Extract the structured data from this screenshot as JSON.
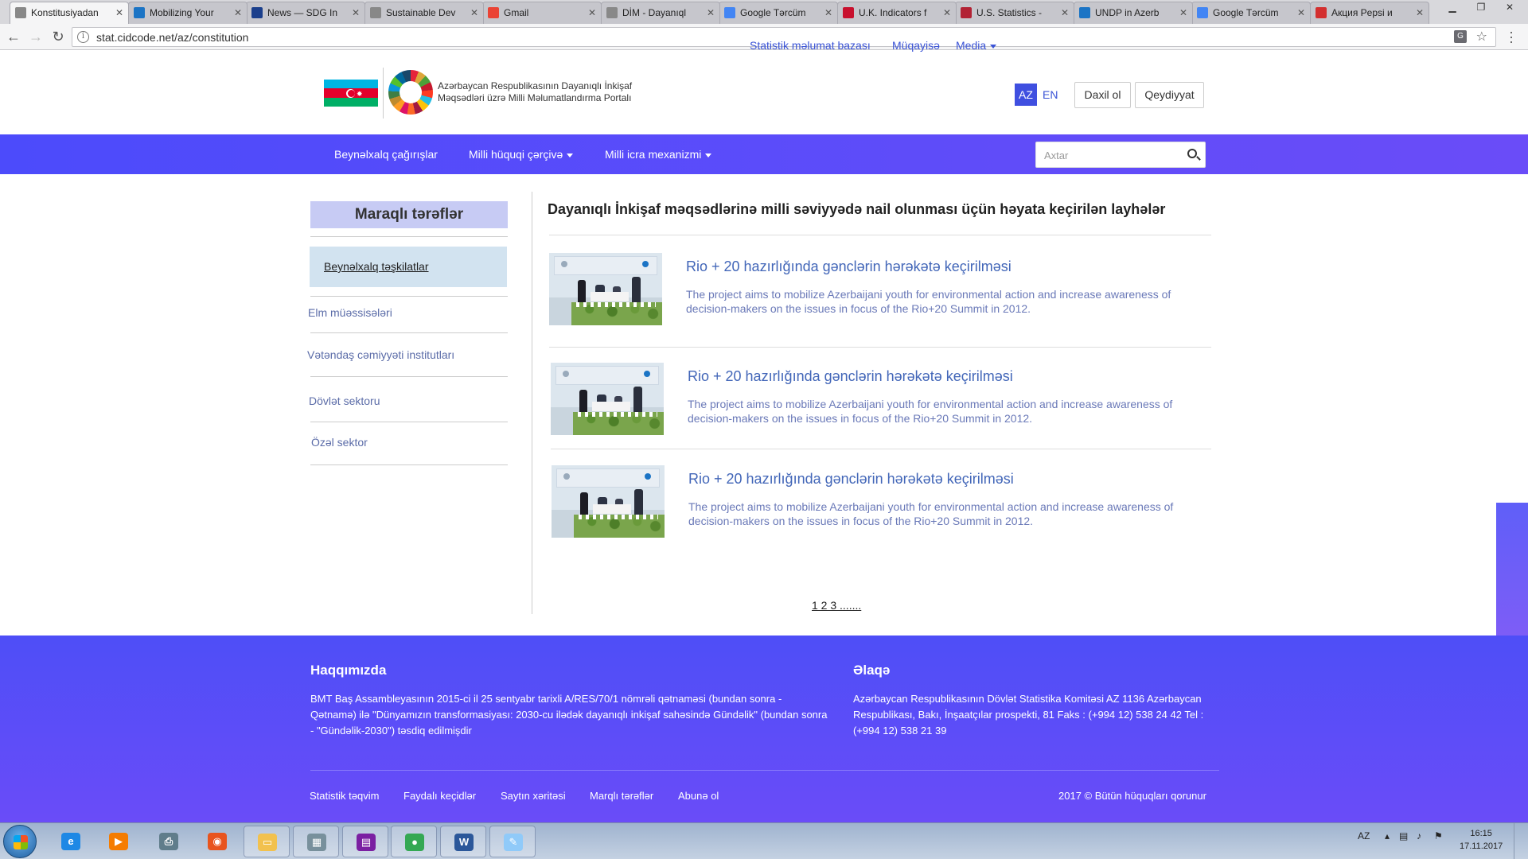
{
  "chrome": {
    "tabs": [
      {
        "label": "Konstitusiyadan",
        "icon": "page-icon",
        "icon_color": "#888888",
        "active": true
      },
      {
        "label": "Mobilizing Your",
        "icon": "un-icon",
        "icon_color": "#1b74c5"
      },
      {
        "label": "News — SDG In",
        "icon": "un-icon",
        "icon_color": "#1b3f8c"
      },
      {
        "label": "Sustainable Dev",
        "icon": "page-icon",
        "icon_color": "#888888"
      },
      {
        "label": "Gmail",
        "icon": "google-icon",
        "icon_color": "#ea4335"
      },
      {
        "label": "DİM - Dayanıql",
        "icon": "page-icon",
        "icon_color": "#888888"
      },
      {
        "label": "Google Tərcüm",
        "icon": "translate-icon",
        "icon_color": "#4285f4"
      },
      {
        "label": "U.K. Indicators f",
        "icon": "uk-flag-icon",
        "icon_color": "#c8102e"
      },
      {
        "label": "U.S. Statistics -",
        "icon": "us-flag-icon",
        "icon_color": "#b22234"
      },
      {
        "label": "UNDP in Azerb",
        "icon": "un-icon",
        "icon_color": "#1b74c5"
      },
      {
        "label": "Google Tərcüm",
        "icon": "translate-icon",
        "icon_color": "#4285f4"
      },
      {
        "label": "Акция Pepsi и",
        "icon": "gift-icon",
        "icon_color": "#d32f2f"
      }
    ],
    "tab_close": "✕",
    "url": "stat.cidcode.net/az/constitution"
  },
  "header": {
    "portal_title": "Azərbaycan Respublikasının Dayanıqlı İnkişaf Məqsədləri üzrə Milli Məlumatlandırma Portalı",
    "topnav": [
      "Statistik məlumat bazası",
      "Müqayisə",
      "Media"
    ],
    "lang_active": "AZ",
    "lang_other": "EN",
    "login": "Daxil ol",
    "register": "Qeydiyyat"
  },
  "mainnav": {
    "items": [
      "Beynəlxalq çağırışlar",
      "Milli hüquqi çərçivə",
      "Milli icra mexanizmi"
    ],
    "search_placeholder": "Axtar"
  },
  "sidebar": {
    "title": "Maraqlı tərəflər",
    "items": [
      "Beynəlxalq təşkilatlar",
      "Elm müəssisələri",
      "Vətəndaş cəmiyyəti institutları",
      "Dövlət  sektoru",
      "Özəl sektor"
    ]
  },
  "main": {
    "title": "Dayanıqlı İnkişaf məqsədlərinə milli səviyyədə nail olunması üçün həyata keçirilən layhələr",
    "items": [
      {
        "title": "Rio + 20 hazırlığında gənclərin hərəkətə keçirilməsi",
        "desc": "The project aims to mobilize Azerbaijani youth for environmental action and increase awareness of decision-makers on the issues in focus of the Rio+20 Summit in 2012."
      },
      {
        "title": "Rio + 20 hazırlığında gənclərin hərəkətə keçirilməsi",
        "desc": "The project aims to mobilize Azerbaijani youth for environmental action and increase awareness of decision-makers on the issues in focus of the Rio+20 Summit in 2012."
      },
      {
        "title": "Rio + 20 hazırlığında gənclərin hərəkətə keçirilməsi",
        "desc": "The project aims to mobilize Azerbaijani youth for environmental action and increase awareness of decision-makers on the issues in focus of the Rio+20 Summit in 2012."
      }
    ],
    "pager": "1 2 3 ......."
  },
  "footer": {
    "about_title": "Haqqımızda",
    "about_text": "BMT Baş Assambleyasının 2015-ci il 25 sentyabr tarixli A/RES/70/1 nömrəli qətnaməsi (bundan sonra - Qətnamə) ilə \"Dünyamızın transformasiyası: 2030-cu ilədək dayanıqlı inkişaf sahəsində Gündəlik\" (bundan sonra - \"Gündəlik-2030\") təsdiq edilmişdir",
    "contact_title": "Əlaqə",
    "contact_text": "Azərbaycan Respublikasının Dövlət Statistika Komitəsi AZ 1136 Azərbaycan Respublikası, Bakı, İnşaatçılar prospekti, 81 Faks : (+994 12) 538 24 42 Tel : (+994 12) 538 21 39",
    "links": [
      "Statistik təqvim",
      "Faydalı keçidlər",
      "Saytın xəritəsi",
      "Marqlı tərəflər",
      "Abunə ol"
    ],
    "copyright": "2017 © Bütün hüquqları qorunur"
  },
  "taskbar": {
    "apps": [
      {
        "name": "internet-explorer-icon",
        "color": "#1e88e5",
        "glyph": "e"
      },
      {
        "name": "media-player-icon",
        "color": "#f57c00",
        "glyph": "▶"
      },
      {
        "name": "printer-icon",
        "color": "#607d8b",
        "glyph": "⎙"
      },
      {
        "name": "firefox-icon",
        "color": "#e8541e",
        "glyph": "◉"
      },
      {
        "name": "file-explorer-icon",
        "color": "#f2c14e",
        "glyph": "▭"
      },
      {
        "name": "calculator-icon",
        "color": "#78909c",
        "glyph": "▦"
      },
      {
        "name": "winrar-icon",
        "color": "#7b1fa2",
        "glyph": "▤"
      },
      {
        "name": "chrome-icon",
        "color": "#34a853",
        "glyph": "●"
      },
      {
        "name": "word-icon",
        "color": "#2b579a",
        "glyph": "W"
      },
      {
        "name": "paint-icon",
        "color": "#90caf9",
        "glyph": "✎"
      }
    ],
    "lang": "AZ",
    "time": "16:15",
    "date": "17.11.2017"
  }
}
